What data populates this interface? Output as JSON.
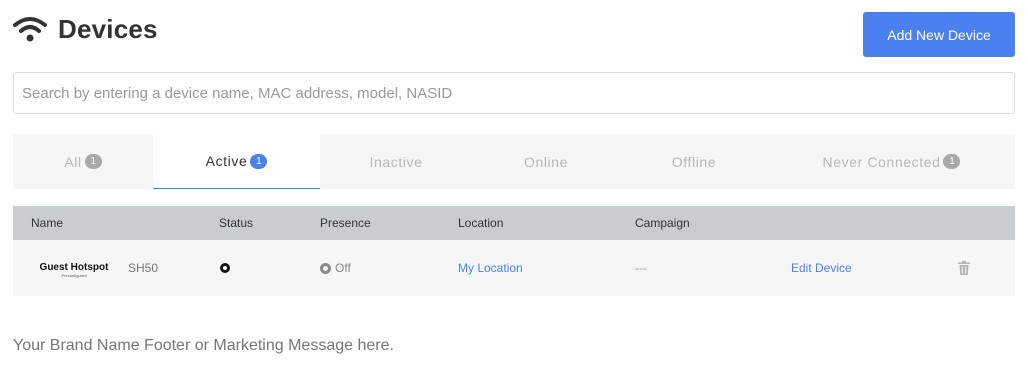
{
  "header": {
    "title": "Devices",
    "icon": "wifi-icon",
    "add_button": "Add New Device"
  },
  "search": {
    "placeholder": "Search by entering a device name, MAC address, model, NASID",
    "value": ""
  },
  "tabs": [
    {
      "label": "All",
      "count": "1",
      "active": false
    },
    {
      "label": "Active",
      "count": "1",
      "active": true
    },
    {
      "label": "Inactive",
      "count": "",
      "active": false
    },
    {
      "label": "Online",
      "count": "",
      "active": false
    },
    {
      "label": "Offline",
      "count": "",
      "active": false
    },
    {
      "label": "Never Connected",
      "count": "1",
      "active": false
    }
  ],
  "table": {
    "columns": {
      "name": "Name",
      "status": "Status",
      "presence": "Presence",
      "location": "Location",
      "campaign": "Campaign"
    },
    "rows": [
      {
        "logo_main": "Guest Hotspot",
        "logo_sub": "Preconfigured",
        "model": "SH50",
        "status_icon": "status-active-icon",
        "presence_icon": "presence-off-icon",
        "presence": "Off",
        "location": "My Location",
        "campaign": "---",
        "edit": "Edit Device",
        "delete_icon": "trash-icon"
      }
    ]
  },
  "footer": {
    "text": "Your Brand Name Footer or Marketing Message here."
  },
  "colors": {
    "accent": "#4a80f0",
    "table_header": "#c9ccd1",
    "tab_bar": "#f6f6f6",
    "badge_inactive": "#a9a9a9"
  }
}
